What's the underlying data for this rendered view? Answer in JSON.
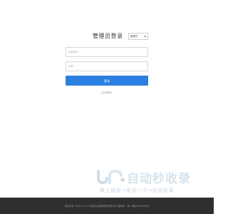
{
  "login": {
    "title": "管理员登录",
    "role_select": {
      "value": "管理员",
      "caret": "▼"
    },
    "username": {
      "placeholder": "您的账号",
      "value": ""
    },
    "password": {
      "placeholder": "密码",
      "value": ""
    },
    "submit_label": "登录",
    "forgot_label": "忘记密码?"
  },
  "watermark": {
    "title": "自动秒收录",
    "subtitle": "做上链接→来访一次→自动收录"
  },
  "footer": {
    "text": "版权所有 ©2019-2024 某某后台管理系统有限公司 备案号：粤ICP备00000000号"
  },
  "colors": {
    "accent": "#2b7fe0",
    "footer_bg": "#2f2f2f",
    "watermark": "#d7e3ec"
  }
}
